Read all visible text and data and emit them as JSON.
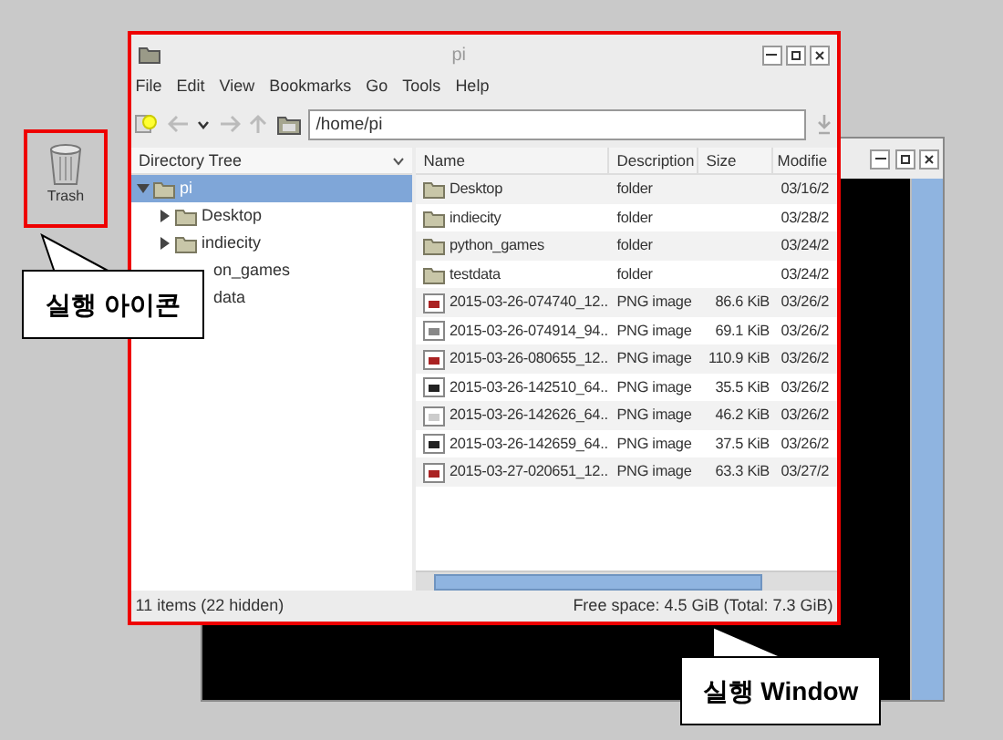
{
  "desktop_icons": [
    {
      "label": "Trash"
    }
  ],
  "callouts": [
    {
      "text": "실행 아이콘"
    },
    {
      "text": "실행 Window"
    }
  ],
  "main_window": {
    "title": "pi",
    "menu": [
      "File",
      "Edit",
      "View",
      "Bookmarks",
      "Go",
      "Tools",
      "Help"
    ],
    "address": "/home/pi",
    "tree": {
      "header": "Directory Tree",
      "items": [
        {
          "label": "pi",
          "expanded": true,
          "selected": true,
          "children": [
            {
              "kind": "folder",
              "label": "Desktop",
              "expanded": false,
              "selected": false
            },
            {
              "kind": "folder",
              "label": "indiecity",
              "expanded": false,
              "selected": false
            },
            {
              "kind": "covered",
              "label": "on_games",
              "selected": false
            },
            {
              "kind": "covered",
              "label": "data",
              "selected": false
            }
          ]
        }
      ]
    },
    "files": {
      "columns": [
        "Name",
        "Description",
        "Size",
        "Modifie"
      ],
      "rows": [
        {
          "kind": "folder",
          "name": "Desktop",
          "description": "folder",
          "size": "",
          "modified": "03/16/2"
        },
        {
          "kind": "folder",
          "name": "indiecity",
          "description": "folder",
          "size": "",
          "modified": "03/28/2"
        },
        {
          "kind": "folder",
          "name": "python_games",
          "description": "folder",
          "size": "",
          "modified": "03/24/2"
        },
        {
          "kind": "folder",
          "name": "testdata",
          "description": "folder",
          "size": "",
          "modified": "03/24/2"
        },
        {
          "kind": "image",
          "name": "2015-03-26-074740_12...",
          "description": "PNG image",
          "size": "86.6 KiB",
          "modified": "03/26/2"
        },
        {
          "kind": "image",
          "name": "2015-03-26-074914_94...",
          "description": "PNG image",
          "size": "69.1 KiB",
          "modified": "03/26/2"
        },
        {
          "kind": "image",
          "name": "2015-03-26-080655_12...",
          "description": "PNG image",
          "size": "110.9 KiB",
          "modified": "03/26/2"
        },
        {
          "kind": "image",
          "name": "2015-03-26-142510_64...",
          "description": "PNG image",
          "size": "35.5 KiB",
          "modified": "03/26/2"
        },
        {
          "kind": "image",
          "name": "2015-03-26-142626_64...",
          "description": "PNG image",
          "size": "46.2 KiB",
          "modified": "03/26/2"
        },
        {
          "kind": "image",
          "name": "2015-03-26-142659_64...",
          "description": "PNG image",
          "size": "37.5 KiB",
          "modified": "03/26/2"
        },
        {
          "kind": "image",
          "name": "2015-03-27-020651_12...",
          "description": "PNG image",
          "size": "63.3 KiB",
          "modified": "03/27/2"
        }
      ]
    },
    "status_bar": {
      "left": "11 items (22 hidden)",
      "right": "Free space: 4.5 GiB (Total: 7.3 GiB)"
    }
  }
}
